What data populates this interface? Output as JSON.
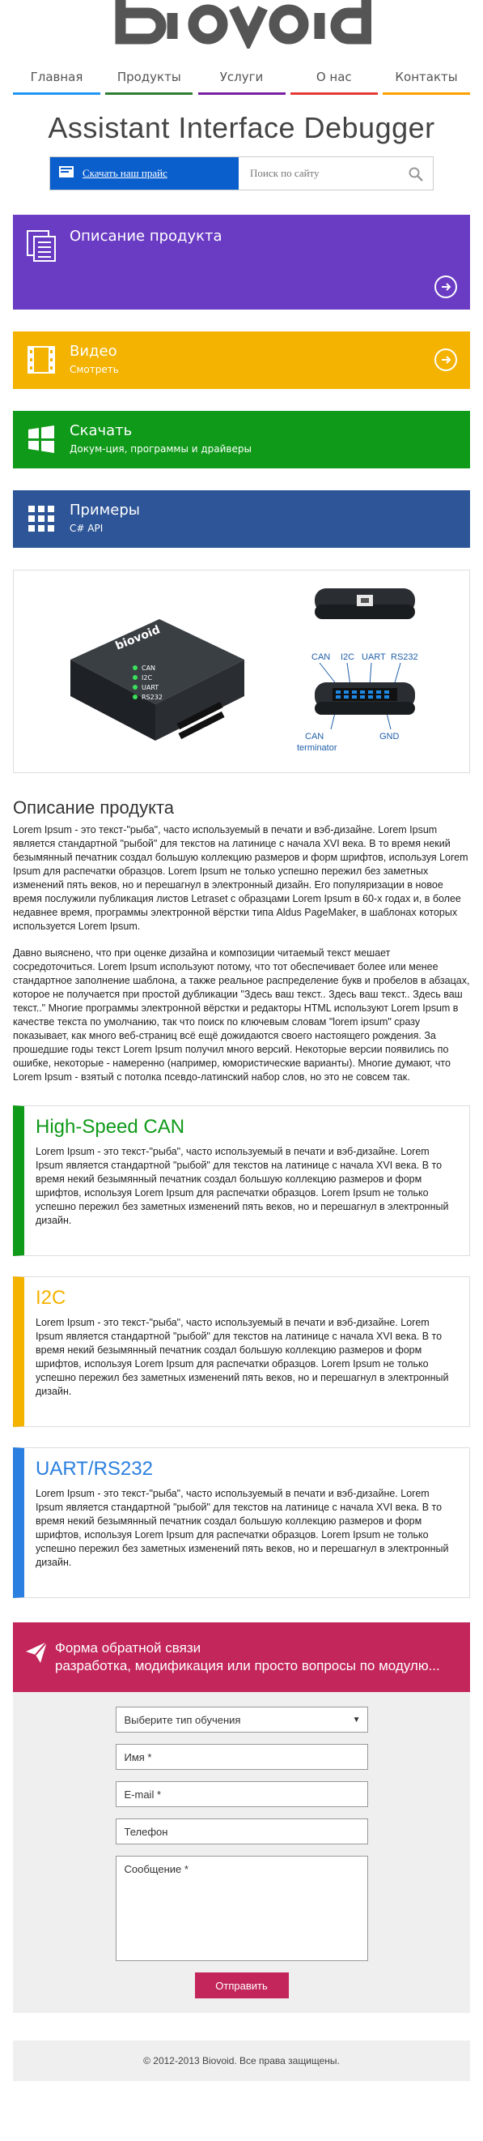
{
  "brand": "Biovoid",
  "nav": [
    {
      "label": "Главная",
      "color": "#2196f3"
    },
    {
      "label": "Продукты",
      "color": "#2e7d32"
    },
    {
      "label": "Услуги",
      "color": "#7b1fa2"
    },
    {
      "label": "О нас",
      "color": "#e53935"
    },
    {
      "label": "Контакты",
      "color": "#ffa000"
    }
  ],
  "page_title": "Assistant Interface Debugger",
  "support_link": "Скачать наш прайс",
  "search_placeholder": "Поиск по сайту",
  "tiles": [
    {
      "title": "Описание продукта",
      "subtitle": "",
      "color": "#6a3cc4",
      "icon": "pages-icon"
    },
    {
      "title": "Видео",
      "subtitle": "Смотреть",
      "color": "#f4b300",
      "icon": "film-icon"
    },
    {
      "title": "Скачать",
      "subtitle": "Докум-ция, программы и драйверы",
      "color": "#0f9a19",
      "icon": "windows-icon"
    },
    {
      "title": "Примеры",
      "subtitle": "C# API",
      "color": "#2d5597",
      "icon": "grid-icon"
    }
  ],
  "device": {
    "brand": "biovoid",
    "leds": [
      "CAN",
      "I2C",
      "UART",
      "RS232"
    ],
    "port_labels": [
      "CAN",
      "I2C",
      "UART",
      "RS232"
    ],
    "port_labels_bottom": [
      "CAN terminator",
      "GND"
    ]
  },
  "description": {
    "heading": "Описание продукта",
    "p1": "Lorem Ipsum - это текст-\"рыба\", часто используемый в печати и вэб-дизайне. Lorem Ipsum является стандартной \"рыбой\" для текстов на латинице с начала XVI века. В то время некий безымянный печатник создал большую коллекцию размеров и форм шрифтов, используя Lorem Ipsum для распечатки образцов. Lorem Ipsum не только успешно пережил без заметных изменений пять веков, но и перешагнул в электронный дизайн. Его популяризации в новое время послужили публикация листов Letraset с образцами Lorem Ipsum в 60-х годах и, в более недавнее время, программы электронной вёрстки типа Aldus PageMaker, в шаблонах которых используется Lorem Ipsum.",
    "p2": "Давно выяснено, что при оценке дизайна и композиции читаемый текст мешает сосредоточиться. Lorem Ipsum используют потому, что тот обеспечивает более или менее стандартное заполнение шаблона, а также реальное распределение букв и пробелов в абзацах, которое не получается при простой дубликации \"Здесь ваш текст.. Здесь ваш текст.. Здесь ваш текст..\" Многие программы электронной вёрстки и редакторы HTML используют Lorem Ipsum в качестве текста по умолчанию, так что поиск по ключевым словам \"lorem ipsum\" сразу показывает, как много веб-страниц всё ещё дожидаются своего настоящего рождения. За прошедшие годы текст Lorem Ipsum получил много версий. Некоторые версии появились по ошибке, некоторые - намеренно (например, юмористические варианты). Многие думают, что Lorem Ipsum - взятый с потолка псевдо-латинский набор слов, но это не совсем так."
  },
  "features": [
    {
      "title": "High-Speed CAN",
      "color": "#0f9a19",
      "text": "Lorem Ipsum - это текст-\"рыба\", часто используемый в печати и вэб-дизайне. Lorem Ipsum является стандартной \"рыбой\" для текстов на латинице с начала XVI века. В то время некий безымянный печатник создал большую коллекцию размеров и форм шрифтов, используя Lorem Ipsum для распечатки образцов. Lorem Ipsum не только успешно пережил без заметных изменений пять веков, но и перешагнул в электронный дизайн."
    },
    {
      "title": "I2C",
      "color": "#f4b300",
      "text": "Lorem Ipsum - это текст-\"рыба\", часто используемый в печати и вэб-дизайне. Lorem Ipsum является стандартной \"рыбой\" для текстов на латинице с начала XVI века. В то время некий безымянный печатник создал большую коллекцию размеров и форм шрифтов, используя Lorem Ipsum для распечатки образцов. Lorem Ipsum не только успешно пережил без заметных изменений пять веков, но и перешагнул в электронный дизайн."
    },
    {
      "title": "UART/RS232",
      "color": "#2b7fe0",
      "text": "Lorem Ipsum - это текст-\"рыба\", часто используемый в печати и вэб-дизайне. Lorem Ipsum является стандартной \"рыбой\" для текстов на латинице с начала XVI века. В то время некий безымянный печатник создал большую коллекцию размеров и форм шрифтов, используя Lorem Ipsum для распечатки образцов. Lorem Ipsum не только успешно пережил без заметных изменений пять веков, но и перешагнул в электронный дизайн."
    }
  ],
  "form": {
    "title": "Форма обратной связи",
    "subtitle": "разработка, модификация или просто вопросы по модулю...",
    "select": "Выберите тип обучения",
    "name": "Имя *",
    "email": "E-mail *",
    "phone": "Телефон",
    "message": "Сообщение *",
    "submit": "Отправить"
  },
  "footer": "© 2012-2013 Biovoid. Все права защищены."
}
